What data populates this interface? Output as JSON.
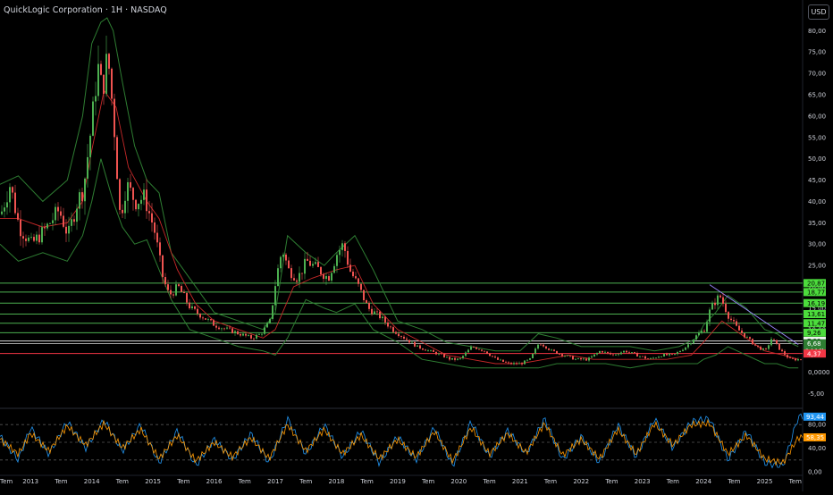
{
  "header": {
    "title": "QuickLogic Corporation · 1H · NASDAQ",
    "currency": "USD"
  },
  "colors": {
    "background": "#000000",
    "up": "#4caf50",
    "down": "#ef5350",
    "bollinger": "#2e7d32",
    "ma": "#c62828",
    "level_line": "#4caf50",
    "level_badge": "#4cdc3c",
    "current_price": "#ffffff",
    "support": "#f23645",
    "stoch_k": "#2196f3",
    "stoch_d": "#ff9800",
    "axis_text": "#d1d4dc",
    "grid_dash": "#555555"
  },
  "chart_data": [
    {
      "type": "line",
      "title": "QuickLogic Corporation · 1H · NASDAQ",
      "subtype": "candlestick with Bollinger bands and horizontal levels",
      "y_ticks": [
        "80,00",
        "75,00",
        "70,00",
        "65,00",
        "60,00",
        "55,00",
        "50,00",
        "45,00",
        "40,00",
        "35,00",
        "30,00",
        "25,00",
        "20,00",
        "15,00",
        "10,00",
        "5,00",
        "0,0000",
        "-5,00"
      ],
      "ylim": [
        -7,
        83
      ],
      "x_ticks": [
        "Tem",
        "2013",
        "Tem",
        "2014",
        "Tem",
        "2015",
        "Tem",
        "2016",
        "Tem",
        "2017",
        "Tem",
        "2018",
        "Tem",
        "2019",
        "Tem",
        "2020",
        "Tem",
        "2021",
        "Tem",
        "2022",
        "Tem",
        "2023",
        "Tem",
        "2024",
        "Tem",
        "2025",
        "Tem"
      ],
      "x_ticks_dates": [
        2012.5,
        2013,
        2013.5,
        2014,
        2014.5,
        2015,
        2015.5,
        2016,
        2016.5,
        2017,
        2017.5,
        2018,
        2018.5,
        2019,
        2019.5,
        2020,
        2020.5,
        2021,
        2021.5,
        2022,
        2022.5,
        2023,
        2023.5,
        2024,
        2024.5,
        2025,
        2025.5
      ],
      "xlim": [
        2012.5,
        2025.62
      ],
      "price_path": {
        "x": [
          2012.5,
          2012.65,
          2012.8,
          2013.0,
          2013.2,
          2013.45,
          2013.6,
          2013.75,
          2013.85,
          2014.0,
          2014.08,
          2014.15,
          2014.25,
          2014.35,
          2014.45,
          2014.55,
          2014.7,
          2014.85,
          2014.95,
          2015.0,
          2015.15,
          2015.25,
          2015.4,
          2015.6,
          2015.8,
          2016.0,
          2016.2,
          2016.4,
          2016.6,
          2016.75,
          2016.9,
          2017.0,
          2017.1,
          2017.2,
          2017.35,
          2017.5,
          2017.7,
          2017.85,
          2018.0,
          2018.1,
          2018.2,
          2018.35,
          2018.5,
          2018.7,
          2018.9,
          2019.1,
          2019.3,
          2019.5,
          2019.7,
          2019.85,
          2020.0,
          2020.2,
          2020.4,
          2020.6,
          2020.8,
          2021.0,
          2021.15,
          2021.3,
          2021.5,
          2021.7,
          2021.9,
          2022.1,
          2022.3,
          2022.5,
          2022.7,
          2022.9,
          2023.1,
          2023.3,
          2023.5,
          2023.7,
          2023.9,
          2024.0,
          2024.1,
          2024.25,
          2024.4,
          2024.55,
          2024.7,
          2024.85,
          2025.0,
          2025.1,
          2025.25,
          2025.4,
          2025.5
        ],
        "y": [
          37,
          44,
          34,
          30,
          33,
          38,
          32,
          40,
          43,
          60,
          72,
          66,
          74,
          58,
          36,
          44,
          40,
          41,
          36,
          34,
          22,
          18,
          20,
          15,
          13,
          11,
          10,
          9,
          8,
          9,
          12,
          22,
          29,
          24,
          22,
          26,
          24,
          22,
          28,
          30,
          24,
          20,
          15,
          13,
          10,
          8,
          6,
          5,
          4,
          3,
          3,
          6,
          5,
          3,
          2,
          2,
          3,
          7,
          5,
          4,
          3,
          3,
          5,
          4,
          5,
          4,
          3,
          4,
          4,
          6,
          9,
          10,
          15,
          18,
          13,
          10,
          8,
          6,
          5,
          8,
          5,
          3,
          3
        ]
      },
      "bollinger_upper": {
        "x": [
          2012.5,
          2012.8,
          2013.2,
          2013.6,
          2013.85,
          2014.0,
          2014.15,
          2014.25,
          2014.35,
          2014.5,
          2014.7,
          2014.9,
          2015.1,
          2015.3,
          2015.6,
          2016.0,
          2016.4,
          2016.8,
          2017.0,
          2017.2,
          2017.5,
          2017.8,
          2018.0,
          2018.3,
          2018.6,
          2019.0,
          2019.4,
          2019.8,
          2020.2,
          2020.6,
          2021.0,
          2021.3,
          2021.6,
          2022.0,
          2022.4,
          2022.8,
          2023.2,
          2023.6,
          2023.9,
          2024.0,
          2024.2,
          2024.4,
          2024.7,
          2025.0,
          2025.2,
          2025.4,
          2025.55
        ],
        "y": [
          44,
          46,
          40,
          45,
          60,
          77,
          82,
          83,
          80,
          68,
          53,
          45,
          42,
          28,
          22,
          14,
          12,
          10,
          14,
          32,
          28,
          25,
          28,
          32,
          24,
          12,
          10,
          7,
          6,
          5,
          5,
          9,
          8,
          6,
          6,
          6,
          5,
          6,
          8,
          11,
          14,
          18,
          15,
          10,
          9,
          7,
          6
        ]
      },
      "bollinger_lower": {
        "x": [
          2012.5,
          2012.8,
          2013.2,
          2013.6,
          2013.85,
          2014.0,
          2014.15,
          2014.35,
          2014.5,
          2014.7,
          2014.9,
          2015.1,
          2015.3,
          2015.6,
          2016.0,
          2016.4,
          2016.8,
          2017.0,
          2017.2,
          2017.5,
          2017.8,
          2018.0,
          2018.3,
          2018.6,
          2019.0,
          2019.4,
          2019.8,
          2020.2,
          2020.6,
          2021.0,
          2021.3,
          2021.6,
          2022.0,
          2022.4,
          2022.8,
          2023.2,
          2023.6,
          2023.9,
          2024.0,
          2024.2,
          2024.4,
          2024.7,
          2025.0,
          2025.2,
          2025.4,
          2025.55
        ],
        "y": [
          30,
          26,
          28,
          26,
          32,
          40,
          50,
          40,
          34,
          30,
          31,
          24,
          17,
          10,
          8,
          6,
          5,
          4,
          8,
          17,
          15,
          14,
          16,
          10,
          7,
          3,
          2,
          1,
          1,
          1,
          1,
          2,
          2,
          2,
          1,
          2,
          2,
          2,
          3,
          4,
          6,
          4,
          2,
          2,
          1,
          1
        ]
      },
      "moving_average": {
        "x": [
          2012.5,
          2012.8,
          2013.2,
          2013.6,
          2013.85,
          2014.0,
          2014.2,
          2014.4,
          2014.6,
          2014.9,
          2015.1,
          2015.4,
          2015.7,
          2016.0,
          2016.4,
          2016.8,
          2017.0,
          2017.3,
          2017.6,
          2018.0,
          2018.3,
          2018.6,
          2019.0,
          2019.4,
          2019.8,
          2020.2,
          2020.6,
          2021.0,
          2021.4,
          2021.8,
          2022.2,
          2022.6,
          2023.0,
          2023.4,
          2023.8,
          2024.0,
          2024.3,
          2024.6,
          2025.0,
          2025.3,
          2025.55
        ],
        "y": [
          36,
          36,
          34,
          35,
          40,
          52,
          66,
          62,
          48,
          40,
          36,
          24,
          16,
          12,
          10,
          8,
          10,
          20,
          22,
          24,
          25,
          16,
          10,
          7,
          4,
          3,
          2,
          2,
          3,
          4,
          3,
          3,
          3,
          3,
          4,
          7,
          12,
          9,
          5,
          4,
          3
        ]
      },
      "horizontal_levels": [
        {
          "value": 20.87,
          "label": "20,87"
        },
        {
          "value": 18.77,
          "label": "18,77"
        },
        {
          "value": 16.19,
          "label": "16,19"
        },
        {
          "value": 13.61,
          "label": "13,61"
        },
        {
          "value": 11.47,
          "label": "11,47"
        },
        {
          "value": 9.26,
          "label": "9,26"
        }
      ],
      "current_price": {
        "value": 7.32,
        "label": "7,32"
      },
      "price_marker": {
        "value": 6.68,
        "label": "6,68",
        "time_left": "2d 16h"
      },
      "support_level": {
        "value": 4.37,
        "label": "4,37"
      },
      "trendline": {
        "x": [
          2024.1,
          2025.55
        ],
        "y": [
          20.5,
          6.5
        ]
      }
    },
    {
      "type": "line",
      "subtype": "stochastic oscillator",
      "y_ticks": [
        "80,00",
        "40,00",
        "0,00"
      ],
      "ylim": [
        0,
        100
      ],
      "dashed_levels": [
        80,
        50,
        20
      ],
      "series": [
        {
          "name": "",
          "color": "#2196f3",
          "x": [
            2012.5,
            2012.8,
            2013.0,
            2013.3,
            2013.6,
            2013.9,
            2014.2,
            2014.5,
            2014.8,
            2015.1,
            2015.4,
            2015.7,
            2016.0,
            2016.3,
            2016.6,
            2016.9,
            2017.2,
            2017.5,
            2017.8,
            2018.1,
            2018.4,
            2018.7,
            2019.0,
            2019.3,
            2019.6,
            2019.9,
            2020.2,
            2020.5,
            2020.8,
            2021.1,
            2021.4,
            2021.7,
            2022.0,
            2022.3,
            2022.6,
            2022.9,
            2023.2,
            2023.5,
            2023.8,
            2024.1,
            2024.4,
            2024.7,
            2025.0,
            2025.3,
            2025.55
          ],
          "y": [
            60,
            20,
            75,
            30,
            85,
            40,
            88,
            35,
            80,
            15,
            70,
            10,
            55,
            20,
            65,
            15,
            90,
            30,
            80,
            25,
            70,
            15,
            60,
            20,
            75,
            10,
            85,
            25,
            70,
            30,
            90,
            20,
            60,
            15,
            80,
            25,
            90,
            40,
            85,
            90,
            20,
            70,
            15,
            10,
            93.44
          ]
        },
        {
          "name": "",
          "color": "#ff9800",
          "x": [
            2012.5,
            2012.8,
            2013.0,
            2013.3,
            2013.6,
            2013.9,
            2014.2,
            2014.5,
            2014.8,
            2015.1,
            2015.4,
            2015.7,
            2016.0,
            2016.3,
            2016.6,
            2016.9,
            2017.2,
            2017.5,
            2017.8,
            2018.1,
            2018.4,
            2018.7,
            2019.0,
            2019.3,
            2019.6,
            2019.9,
            2020.2,
            2020.5,
            2020.8,
            2021.1,
            2021.4,
            2021.7,
            2022.0,
            2022.3,
            2022.6,
            2022.9,
            2023.2,
            2023.5,
            2023.8,
            2024.1,
            2024.4,
            2024.7,
            2025.0,
            2025.3,
            2025.55
          ],
          "y": [
            55,
            30,
            65,
            35,
            78,
            45,
            82,
            40,
            72,
            22,
            62,
            18,
            50,
            25,
            58,
            22,
            80,
            35,
            72,
            30,
            62,
            22,
            55,
            25,
            68,
            18,
            75,
            30,
            65,
            32,
            82,
            28,
            55,
            22,
            72,
            30,
            82,
            45,
            80,
            82,
            30,
            62,
            22,
            15,
            58.35
          ]
        }
      ],
      "value_labels": [
        {
          "value": 93.44,
          "label": "93,44",
          "color": "#2196f3"
        },
        {
          "value": 58.35,
          "label": "58,35",
          "color": "#ff9800"
        }
      ]
    }
  ]
}
